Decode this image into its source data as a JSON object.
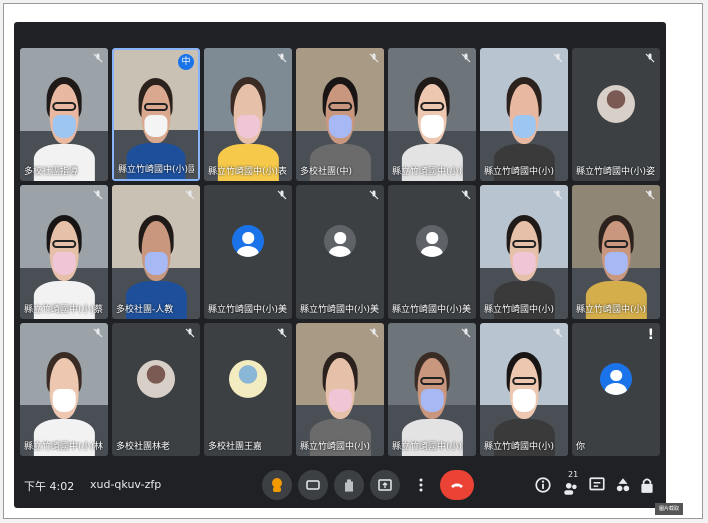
{
  "meeting": {
    "clock": "下午 4:02",
    "code": "xud-qkuv-zfp",
    "participant_count": "21"
  },
  "colors": {
    "window_bg": "#202124",
    "tile_bg": "#3c4043",
    "avatar_blue": "#1a73e8",
    "avatar_gray": "#5f6368",
    "end_call_red": "#ea4335",
    "hand_accent": "#f29900"
  },
  "tiles": [
    {
      "name": "多校社團指導",
      "type": "video",
      "mic": "muted"
    },
    {
      "name": "縣立竹崎國中(小)國",
      "type": "video",
      "mic": "speaking",
      "badge": "中"
    },
    {
      "name": "縣立竹崎國中(小)表",
      "type": "video",
      "mic": "muted"
    },
    {
      "name": "多校社團(中)",
      "type": "video",
      "mic": "muted"
    },
    {
      "name": "縣立竹崎國中(小)",
      "type": "video",
      "mic": "muted"
    },
    {
      "name": "縣立竹崎國中(小)",
      "type": "video",
      "mic": "muted"
    },
    {
      "name": "縣立竹崎國中(小)姿",
      "type": "photo",
      "mic": "muted"
    },
    {
      "name": "縣立竹崎國中(小)蔡",
      "type": "video",
      "mic": "muted"
    },
    {
      "name": "多校社團-人教",
      "type": "video",
      "mic": "muted"
    },
    {
      "name": "縣立竹崎國中(小)美",
      "type": "avatar",
      "avatar_color": "blue",
      "mic": "muted"
    },
    {
      "name": "縣立竹崎國中(小)美",
      "type": "avatar",
      "avatar_color": "gray",
      "mic": "muted"
    },
    {
      "name": "縣立竹崎國中(小)美",
      "type": "avatar",
      "avatar_color": "gray",
      "mic": "muted"
    },
    {
      "name": "縣立竹崎國中(小)",
      "type": "video",
      "mic": "muted"
    },
    {
      "name": "縣立竹崎國中(小)",
      "type": "video",
      "mic": "muted"
    },
    {
      "name": "縣立竹崎國中(小)林",
      "type": "video",
      "mic": "muted"
    },
    {
      "name": "多校社團林老",
      "type": "photo",
      "mic": "muted"
    },
    {
      "name": "多校社團王嘉",
      "type": "photo",
      "mic": "muted"
    },
    {
      "name": "縣立竹崎國中(小)",
      "type": "video",
      "mic": "muted"
    },
    {
      "name": "縣立竹崎國中(小)",
      "type": "video",
      "mic": "muted"
    },
    {
      "name": "縣立竹崎國中(小)",
      "type": "video",
      "mic": "muted"
    },
    {
      "name": "你",
      "type": "avatar",
      "avatar_color": "blue",
      "mic": "alert"
    }
  ],
  "controls": {
    "left": [
      "hand-raised-icon",
      "captions-icon",
      "raise-hand-icon",
      "present-icon",
      "more-options-icon",
      "end-call-icon"
    ],
    "right": [
      "info-icon",
      "people-icon",
      "chat-icon",
      "activities-icon",
      "lock-icon"
    ]
  },
  "footer_stamp": "圖片截取"
}
